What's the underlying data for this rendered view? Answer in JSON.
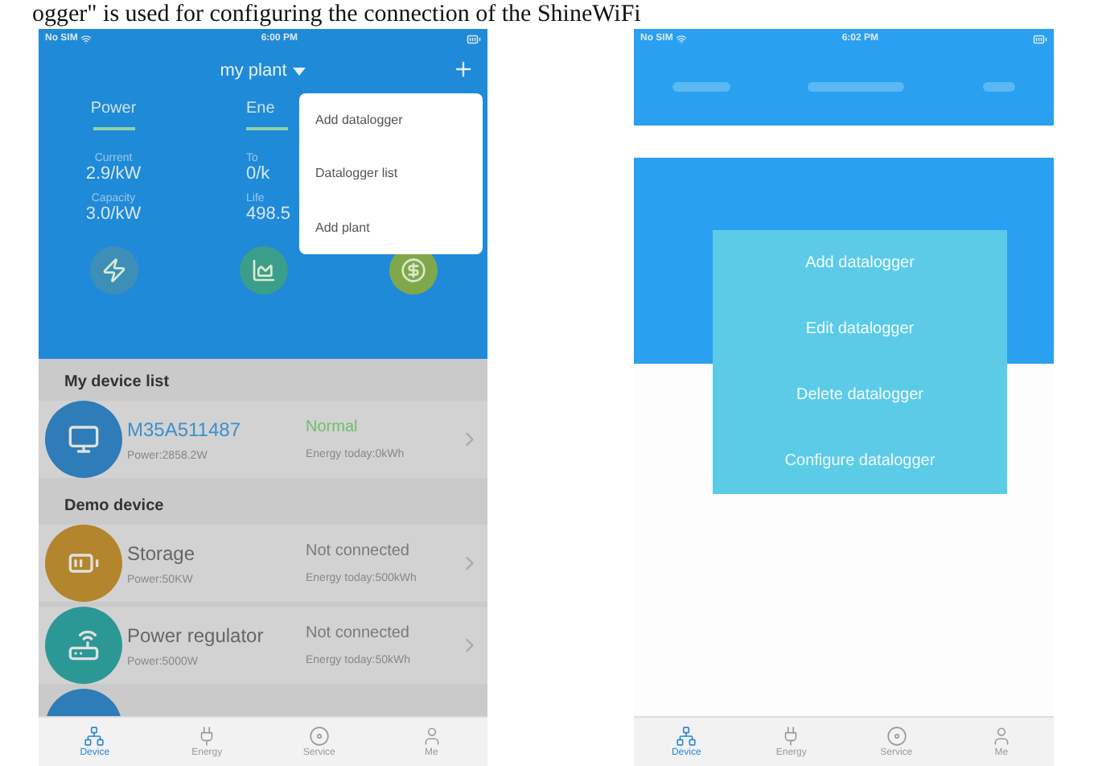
{
  "caption": "ogger\" is used for configuring the connection of the ShineWiFi",
  "left_phone": {
    "status_bar": {
      "carrier": "No SIM",
      "time": "6:00 PM"
    },
    "title": "my plant",
    "tabs": [
      "Power",
      "Ene"
    ],
    "stat_columns": [
      {
        "items": [
          {
            "label": "Current",
            "value": "2.9/kW"
          },
          {
            "label": "Capacity",
            "value": "3.0/kW"
          }
        ]
      },
      {
        "items": [
          {
            "label": "To",
            "value": "0/k"
          },
          {
            "label": "Life",
            "value": "498.5"
          }
        ]
      }
    ],
    "menu": [
      "Add datalogger",
      "Datalogger list",
      "Add plant"
    ],
    "sections": [
      {
        "title": "My device list",
        "devices": [
          {
            "name": "M35A511487",
            "status": "Normal",
            "online": true,
            "power": "Power:2858.2W",
            "energy": "Energy today:0kWh",
            "color": "#2e7db8"
          }
        ]
      },
      {
        "title": "Demo device",
        "devices": [
          {
            "name": "Storage",
            "status": "Not connected",
            "online": false,
            "power": "Power:50KW",
            "energy": "Energy today:500kWh",
            "color": "#b3852c"
          },
          {
            "name": "Power regulator",
            "status": "Not connected",
            "online": false,
            "power": "Power:5000W",
            "energy": "Energy today:50kWh",
            "color": "#2c9896"
          }
        ]
      }
    ],
    "bottom_nav": [
      {
        "label": "Device",
        "selected": true
      },
      {
        "label": "Energy",
        "selected": false
      },
      {
        "label": "Service",
        "selected": false
      },
      {
        "label": "Me",
        "selected": false
      }
    ]
  },
  "right_phone": {
    "status_bar": {
      "carrier": "No SIM",
      "time": "6:02 PM"
    },
    "action_sheet": [
      "Add datalogger",
      "Edit datalogger",
      "Delete datalogger",
      "Configure datalogger"
    ],
    "bottom_nav": [
      {
        "label": "Device",
        "selected": true
      },
      {
        "label": "Energy",
        "selected": false
      },
      {
        "label": "Service",
        "selected": false
      },
      {
        "label": "Me",
        "selected": false
      }
    ]
  }
}
